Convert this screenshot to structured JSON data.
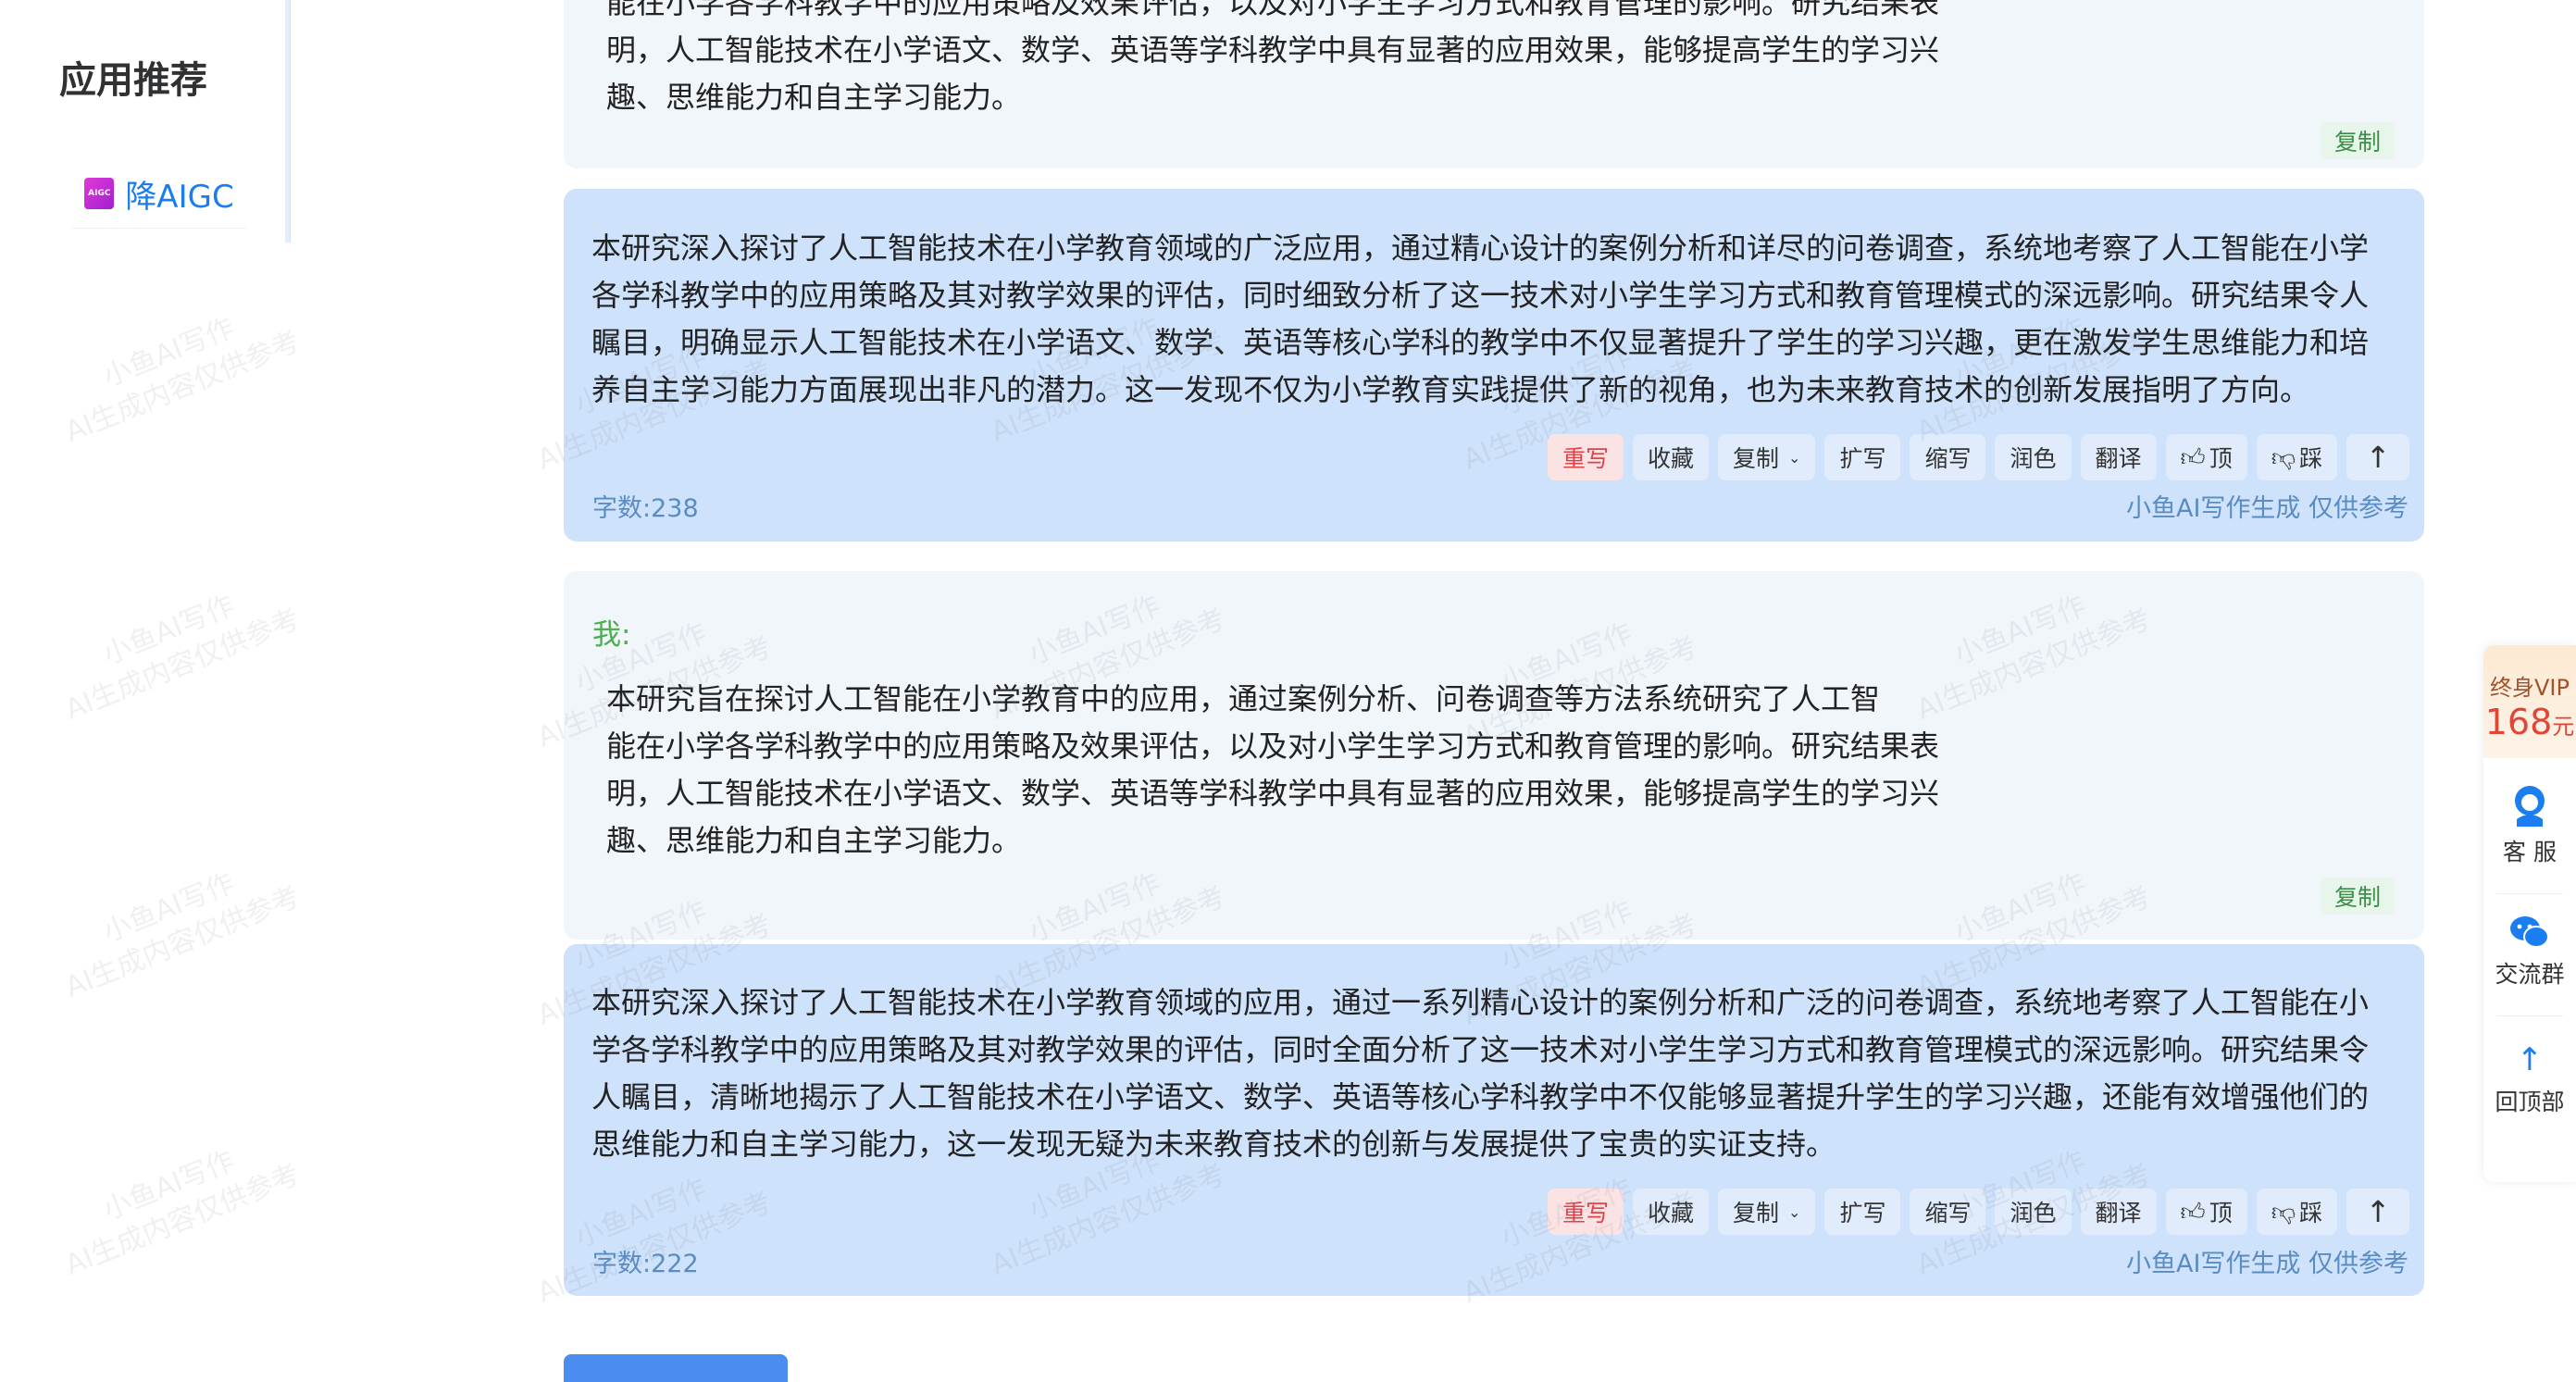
{
  "sidebar": {
    "title": "应用推荐",
    "items": [
      {
        "icon": "aigc-icon",
        "icon_text": "AIGC",
        "label": "降AIGC"
      }
    ]
  },
  "watermark": {
    "line1": "小鱼AI写作",
    "line2": "AI生成内容仅供参考"
  },
  "top_user_message": {
    "lines": [
      "能在小学各学科教学中的应用策略及效果评估，以及对小学生学习方式和教育管理的影响。研究结果表",
      "明，人工智能技术在小学语文、数学、英语等学科教学中具有显著的应用效果，能够提高学生的学习兴",
      "趣、思维能力和自主学习能力。"
    ],
    "copy_label": "复制"
  },
  "ai_response_1": {
    "lines": [
      "本研究深入探讨了人工智能技术在小学教育领域的广泛应用，通过精心设计的案例分析和详尽的问卷调查，系统地考察了人工智能在小学",
      "各学科教学中的应用策略及其对教学效果的评估，同时细致分析了这一技术对小学生学习方式和教育管理模式的深远影响。研究结果令人",
      "瞩目，明确显示人工智能技术在小学语文、数学、英语等核心学科的教学中不仅显著提升了学生的学习兴趣，更在激发学生思维能力和培",
      "养自主学习能力方面展现出非凡的潜力。这一发现不仅为小学教育实践提供了新的视角，也为未来教育技术的创新发展指明了方向。"
    ],
    "word_count": "字数:238",
    "source_note": "小鱼AI写作生成 仅供参考"
  },
  "user_message_2": {
    "label": "我:",
    "lines": [
      "本研究旨在探讨人工智能在小学教育中的应用，通过案例分析、问卷调查等方法系统研究了人工智",
      "能在小学各学科教学中的应用策略及效果评估，以及对小学生学习方式和教育管理的影响。研究结果表",
      "明，人工智能技术在小学语文、数学、英语等学科教学中具有显著的应用效果，能够提高学生的学习兴",
      "趣、思维能力和自主学习能力。"
    ],
    "copy_label": "复制"
  },
  "ai_response_2": {
    "lines": [
      "本研究深入探讨了人工智能技术在小学教育领域的应用，通过一系列精心设计的案例分析和广泛的问卷调查，系统地考察了人工智能在小",
      "学各学科教学中的应用策略及其对教学效果的评估，同时全面分析了这一技术对小学生学习方式和教育管理模式的深远影响。研究结果令",
      "人瞩目，清晰地揭示了人工智能技术在小学语文、数学、英语等核心学科教学中不仅能够显著提升学生的学习兴趣，还能有效增强他们的",
      "思维能力和自主学习能力，这一发现无疑为未来教育技术的创新与发展提供了宝贵的实证支持。"
    ],
    "word_count": "字数:222",
    "source_note": "小鱼AI写作生成 仅供参考"
  },
  "toolbar": {
    "rewrite": "重写",
    "favorite": "收藏",
    "copy": "复制",
    "expand": "扩写",
    "shorten": "缩写",
    "polish": "润色",
    "translate": "翻译",
    "like": "顶",
    "dislike": "踩",
    "accent_red": "#e0424a"
  },
  "rightbar": {
    "vip_label": "终身VIP",
    "vip_price": "168",
    "vip_unit": "元",
    "support": "客 服",
    "group": "交流群",
    "back_top": "回顶部"
  }
}
